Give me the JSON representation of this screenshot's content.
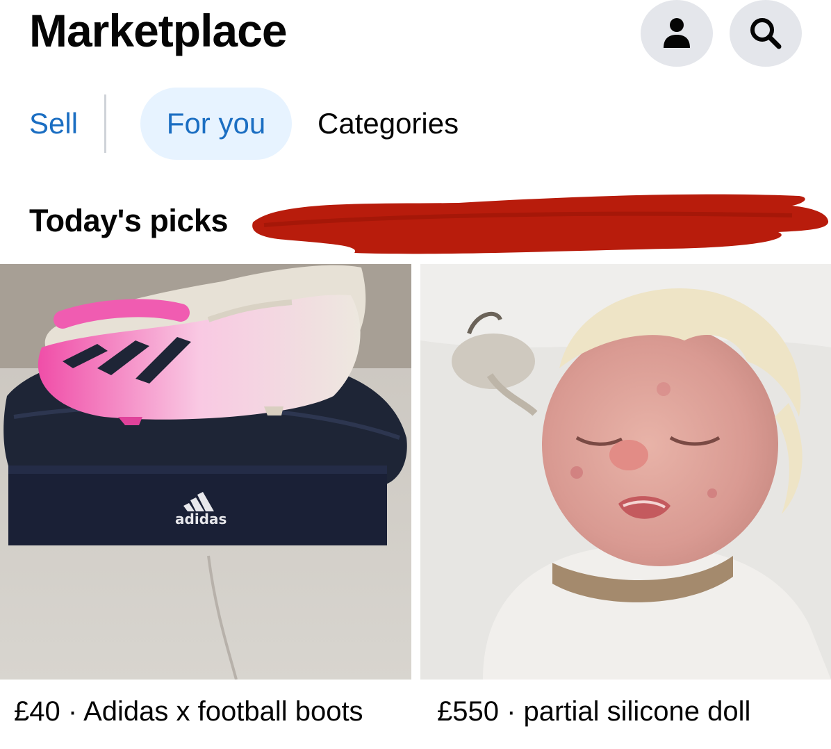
{
  "header": {
    "title": "Marketplace",
    "profile_icon": "person-icon",
    "search_icon": "search-icon"
  },
  "tabs": {
    "sell": "Sell",
    "for_you": "For you",
    "categories": "Categories"
  },
  "section": {
    "title": "Today's picks"
  },
  "listings": [
    {
      "price": "£40",
      "separator": "·",
      "title": "Adidas x football boots",
      "caption": "£40 · Adidas x football boots",
      "box_brand": "adidas"
    },
    {
      "price": "£550",
      "separator": "·",
      "title": "partial silicone doll",
      "caption": "£550 · partial silicone doll"
    }
  ],
  "colors": {
    "accent": "#1b6ec2",
    "tab_active_bg": "#e7f3ff",
    "icon_button_bg": "#e4e6eb",
    "redaction": "#b81c0c",
    "text": "#050505"
  }
}
